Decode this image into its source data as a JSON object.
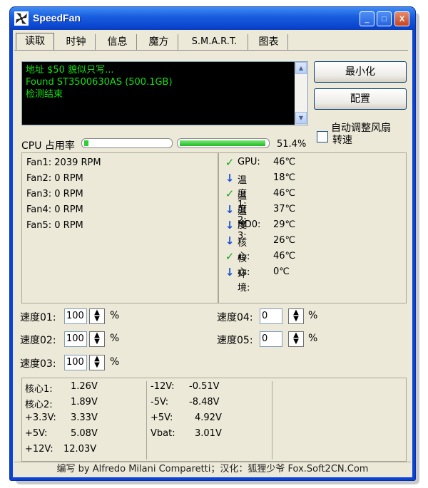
{
  "window": {
    "title": "SpeedFan",
    "minimize_glyph": "_",
    "maximize_glyph": "□",
    "close_glyph": "X"
  },
  "tabs": [
    {
      "label": "读取",
      "selected": true
    },
    {
      "label": "时钟"
    },
    {
      "label": "信息"
    },
    {
      "label": "魔方"
    },
    {
      "label": "S.M.A.R.T."
    },
    {
      "label": "图表"
    }
  ],
  "console": {
    "lines": [
      "地址 $50 貌似只写...",
      "Found ST3500630AS (500.1GB)",
      "检测结束"
    ]
  },
  "buttons": {
    "minimize": "最小化",
    "config": "配置"
  },
  "auto_fan": {
    "label_line1": "自动调整风扇",
    "label_line2": "转速",
    "checked": false
  },
  "cpu": {
    "label": "CPU 占用率",
    "percent_text": "51.4%",
    "core1_fraction": 0.05,
    "core2_fraction": 0.98
  },
  "fans": [
    "Fan1: 2039 RPM",
    "Fan2: 0 RPM",
    "Fan3: 0 RPM",
    "Fan4: 0 RPM",
    "Fan5: 0 RPM"
  ],
  "temps": [
    {
      "label": "GPU:",
      "value": "46℃",
      "icon": "check-icon"
    },
    {
      "label": "温度1:",
      "value": "18℃",
      "icon": "down-arrow-icon"
    },
    {
      "label": "温度2:",
      "value": "46℃",
      "icon": "check-icon"
    },
    {
      "label": "温度3:",
      "value": "37℃",
      "icon": "down-arrow-icon"
    },
    {
      "label": "HD0:",
      "value": "29℃",
      "icon": "down-arrow-icon"
    },
    {
      "label": "核心:",
      "value": "26℃",
      "icon": "down-arrow-icon"
    },
    {
      "label": "核心:",
      "value": "46℃",
      "icon": "check-icon"
    },
    {
      "label": "环境:",
      "value": "0℃",
      "icon": "down-arrow-icon"
    }
  ],
  "speeds": [
    {
      "label": "速度01:",
      "value": "100",
      "unit": "%"
    },
    {
      "label": "速度02:",
      "value": "100",
      "unit": "%"
    },
    {
      "label": "速度03:",
      "value": "100",
      "unit": "%"
    },
    {
      "label": "速度04:",
      "value": "0",
      "unit": "%"
    },
    {
      "label": "速度05:",
      "value": "0",
      "unit": "%"
    }
  ],
  "voltages": [
    {
      "label": "核心1:",
      "value": "1.26V"
    },
    {
      "label": "核心2:",
      "value": "1.89V"
    },
    {
      "label": "+3.3V:",
      "value": "3.33V"
    },
    {
      "label": "+5V:",
      "value": "5.08V"
    },
    {
      "label": "+12V:",
      "value": "12.03V"
    },
    {
      "label": "-12V:",
      "value": "-0.51V"
    },
    {
      "label": "-5V:",
      "value": "-8.48V"
    },
    {
      "label": "+5V:",
      "value": "4.92V"
    },
    {
      "label": "Vbat:",
      "value": "3.01V"
    }
  ],
  "status": "编写 by Alfredo Milani Comparetti；汉化：狐狸少爷 Fox.Soft2CN.Com"
}
